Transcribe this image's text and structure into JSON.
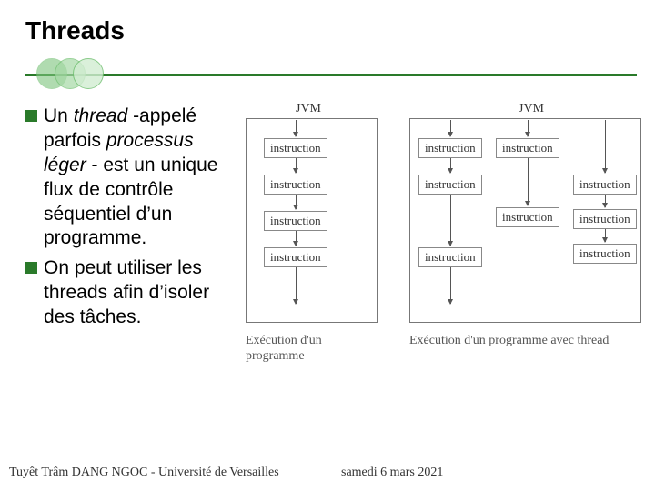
{
  "title": "Threads",
  "bullets": [
    {
      "prefix": "Un ",
      "italic1": "thread",
      "mid1": " -appelé parfois ",
      "italic2": "processus léger",
      "rest": " - est un unique flux de contrôle séquentiel d’un programme."
    },
    {
      "prefix": "On peut utiliser les threads afin d’isoler des tâches.",
      "italic1": "",
      "mid1": "",
      "italic2": "",
      "rest": ""
    }
  ],
  "diagram": {
    "jvm_label": "JVM",
    "instr_label": "instruction",
    "caption_left": "Exécution d'un programme",
    "caption_right": "Exécution d'un programme avec thread"
  },
  "footer": {
    "author": "Tuyêt Trâm DANG NGOC - Université de Versailles",
    "date": "samedi 6 mars 2021"
  }
}
